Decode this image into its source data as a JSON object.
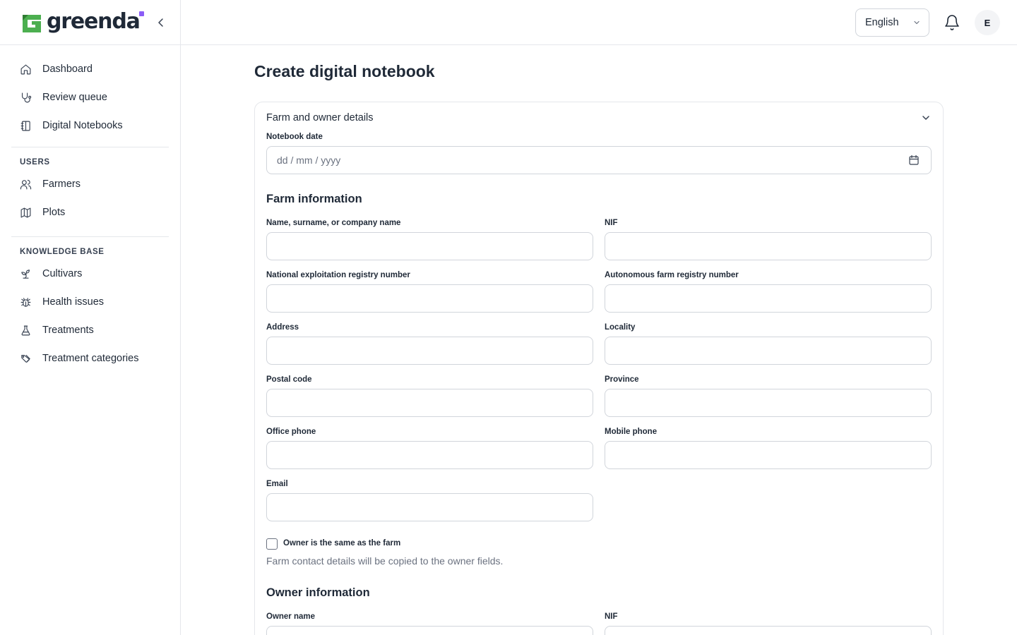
{
  "brand": {
    "name": "greenda",
    "logo_colors": {
      "mark": "#4caf50",
      "dot": "#8b5cf6"
    }
  },
  "sidebar": {
    "primary": [
      {
        "label": "Dashboard",
        "icon": "home-icon"
      },
      {
        "label": "Review queue",
        "icon": "stethoscope-icon"
      },
      {
        "label": "Digital Notebooks",
        "icon": "notebook-icon"
      }
    ],
    "users_section": {
      "title": "USERS",
      "items": [
        {
          "label": "Farmers",
          "icon": "users-icon"
        },
        {
          "label": "Plots",
          "icon": "map-icon"
        }
      ]
    },
    "kb_section": {
      "title": "KNOWLEDGE BASE",
      "items": [
        {
          "label": "Cultivars",
          "icon": "sprout-icon"
        },
        {
          "label": "Health issues",
          "icon": "bug-icon"
        },
        {
          "label": "Treatments",
          "icon": "flask-icon"
        },
        {
          "label": "Treatment categories",
          "icon": "tags-icon"
        }
      ]
    }
  },
  "header": {
    "language": "English",
    "avatar_initial": "E"
  },
  "page": {
    "title": "Create digital notebook",
    "card_title": "Farm and owner details",
    "notebook_date": {
      "label": "Notebook date",
      "placeholder": "dd / mm / yyyy"
    },
    "farm": {
      "title": "Farm information",
      "name_label": "Name, surname, or company name",
      "nif_label": "NIF",
      "national_registry_label": "National exploitation registry number",
      "autonomous_registry_label": "Autonomous farm registry number",
      "address_label": "Address",
      "locality_label": "Locality",
      "postal_code_label": "Postal code",
      "province_label": "Province",
      "office_phone_label": "Office phone",
      "mobile_phone_label": "Mobile phone",
      "email_label": "Email"
    },
    "owner_same": {
      "label": "Owner is the same as the farm",
      "hint": "Farm contact details will be copied to the owner fields.",
      "checked": false
    },
    "owner": {
      "title": "Owner information",
      "name_label": "Owner name",
      "nif_label": "NIF"
    }
  }
}
